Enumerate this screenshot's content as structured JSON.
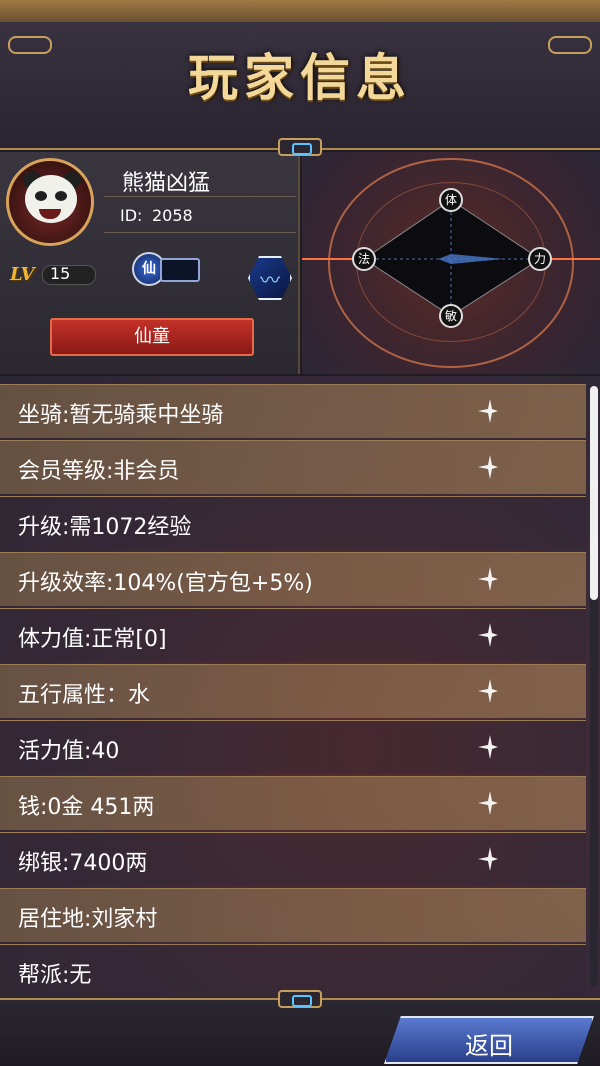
{
  "header": {
    "title": "玩家信息"
  },
  "profile": {
    "name": "熊猫凶猛",
    "id_label": "ID:",
    "id_value": "2058",
    "level_label": "LV",
    "level_value": "15",
    "school_badge": "仙",
    "title_label": "仙童"
  },
  "stats_wheel": {
    "top": "体",
    "right": "力",
    "bottom": "敏",
    "left": "法"
  },
  "info_rows": [
    {
      "text": "坐骑:暂无骑乘中坐骑",
      "has_action": true
    },
    {
      "text": "会员等级:非会员",
      "has_action": true
    },
    {
      "text": "升级:需1072经验",
      "has_action": false
    },
    {
      "text": "升级效率:104%(官方包+5%)",
      "has_action": true
    },
    {
      "text": "体力值:正常[0]",
      "has_action": true
    },
    {
      "text": "五行属性：水",
      "has_action": true
    },
    {
      "text": "活力值:40",
      "has_action": true
    },
    {
      "text": "钱:0金 451两",
      "has_action": true
    },
    {
      "text": "绑银:7400两",
      "has_action": true
    },
    {
      "text": "居住地:刘家村",
      "has_action": false
    },
    {
      "text": "帮派:无",
      "has_action": false
    }
  ],
  "footer": {
    "back_label": "返回"
  },
  "colors": {
    "accent_gold": "#c79f5d",
    "banner_red": "#c33128",
    "button_blue": "#2a3f8a"
  }
}
